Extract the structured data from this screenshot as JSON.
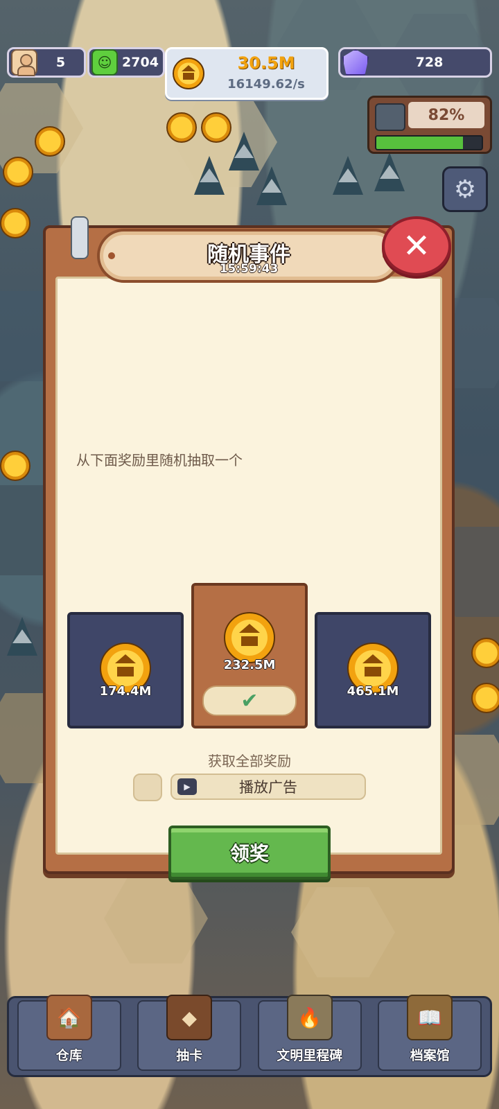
{
  "hud": {
    "population": "5",
    "happiness": "2704",
    "gold": "30.5M",
    "gold_rate": "16149.62/s",
    "gems": "728",
    "threat_percent": "82%",
    "threat_level": 0.82
  },
  "dialog": {
    "title": "随机事件",
    "timer": "15:59:43",
    "description": "从下面奖励里随机抽取一个",
    "rewards": [
      {
        "amount": "174.4M",
        "selected": false
      },
      {
        "amount": "232.5M",
        "selected": true
      },
      {
        "amount": "465.1M",
        "selected": false
      }
    ],
    "all_rewards_label": "获取全部奖励",
    "watch_ad_label": "播放广告",
    "claim_label": "领奖"
  },
  "nav": {
    "items": [
      {
        "label": "仓库",
        "icon": "warehouse-icon"
      },
      {
        "label": "抽卡",
        "icon": "card-draw-icon"
      },
      {
        "label": "文明里程碑",
        "icon": "milestone-icon"
      },
      {
        "label": "档案馆",
        "icon": "archive-icon"
      }
    ]
  },
  "colors": {
    "panel": "#b56f45",
    "panel_inner": "#fbf3dd",
    "card": "#3f4668",
    "claim_button": "#64b84e",
    "close_button": "#e04b53",
    "gold_text": "#f2a20f"
  }
}
